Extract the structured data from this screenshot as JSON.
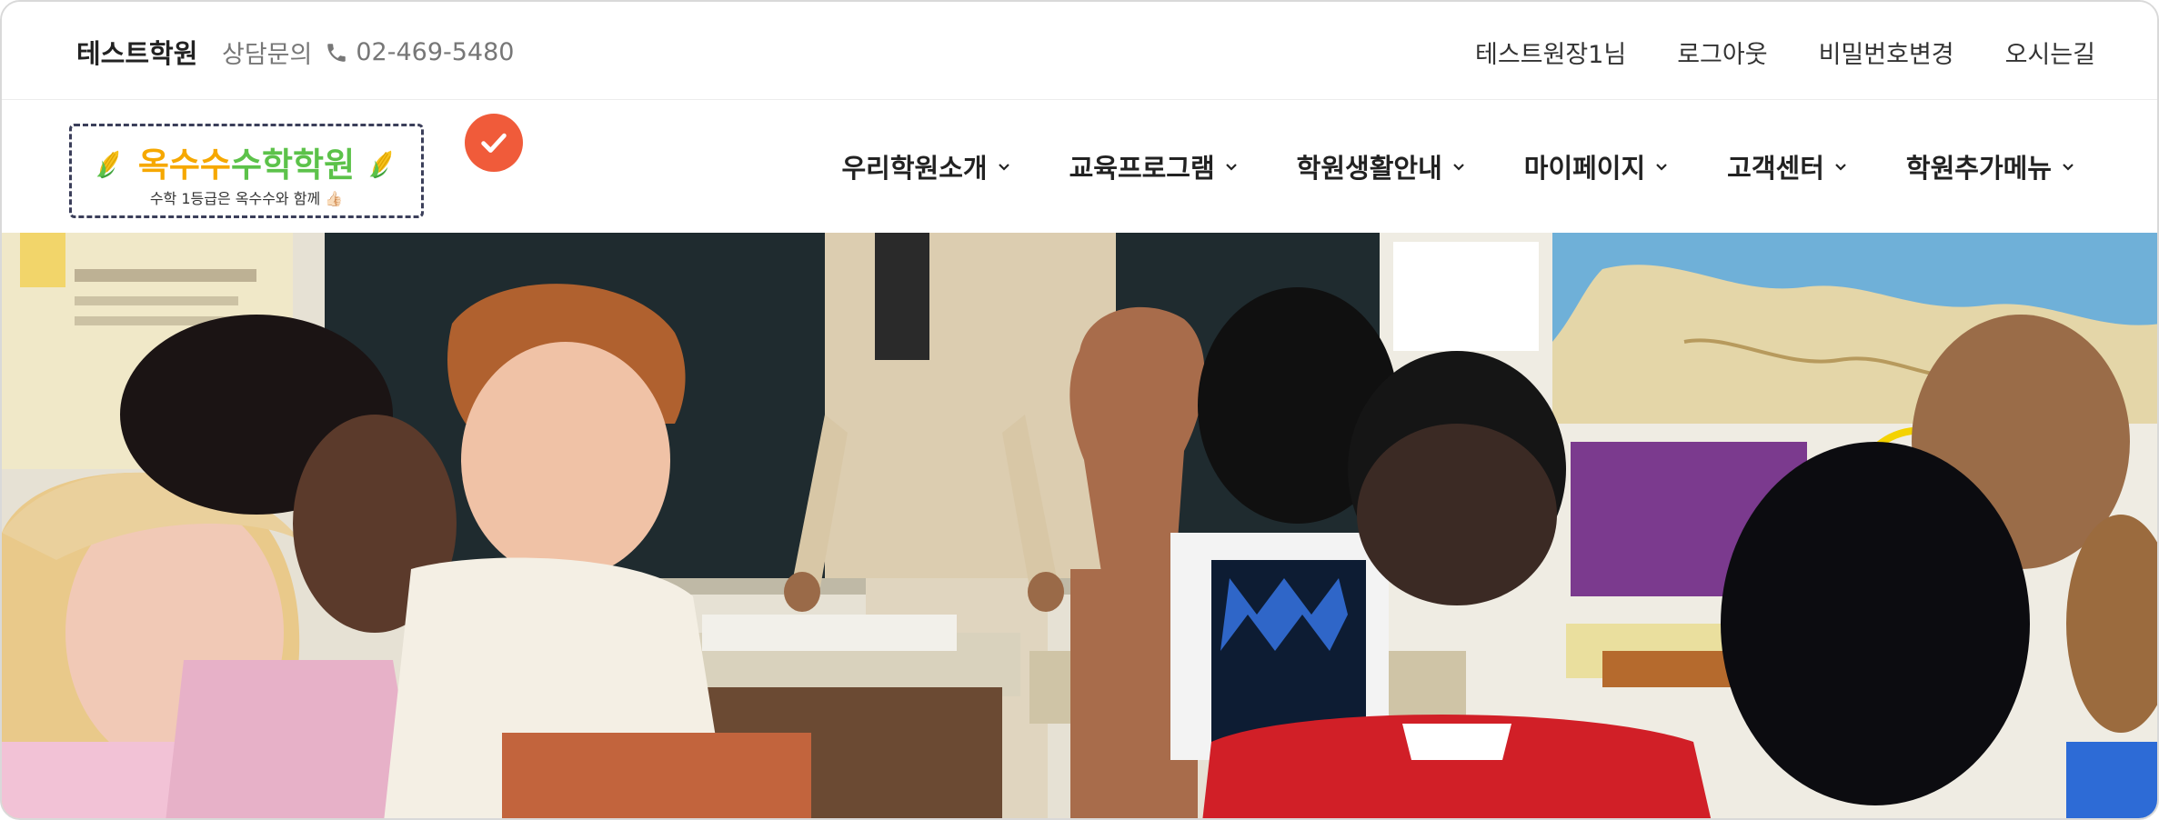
{
  "topbar": {
    "academy_name": "테스트학원",
    "contact_label": "상담문의",
    "phone_icon": "phone-icon",
    "phone_number": "02-469-5480",
    "links": [
      "테스트원장1님",
      "로그아웃",
      "비밀번호변경",
      "오시는길"
    ]
  },
  "logo": {
    "title_part1": "옥수수",
    "title_part2": "수학학원",
    "subtitle": "수학 1등급은 옥수수와 함께 👍🏻",
    "icon": "corn-icon",
    "badge_icon": "check-icon"
  },
  "nav": {
    "menu": [
      "우리학원소개",
      "교육프로그램",
      "학원생활안내",
      "마이페이지",
      "고객센터",
      "학원추가메뉴"
    ]
  },
  "colors": {
    "logo_orange": "#f6a800",
    "logo_green": "#5cc24a",
    "badge_red": "#f05b3a",
    "text_dark": "#222222",
    "text_muted": "#777777"
  },
  "hero": {
    "image_subject": "classroom-photo"
  }
}
